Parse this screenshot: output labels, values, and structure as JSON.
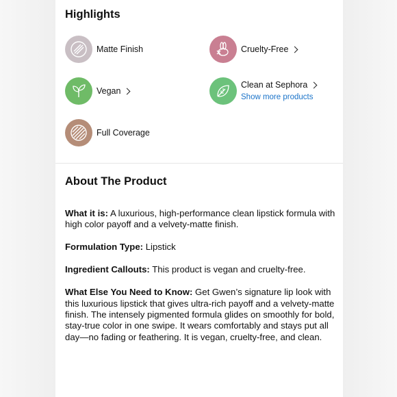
{
  "highlights": {
    "title": "Highlights",
    "items": [
      {
        "label": "Matte Finish",
        "icon": "matte-finish-icon",
        "color": "#c9bfc4",
        "chevron": false
      },
      {
        "label": "Cruelty-Free",
        "icon": "bunny-icon",
        "color": "#c97f92",
        "chevron": true
      },
      {
        "label": "Vegan",
        "icon": "leaf-sprout-icon",
        "color": "#6fbb67",
        "chevron": true
      },
      {
        "label": "Clean at Sephora",
        "icon": "clean-leaf-icon",
        "color": "#6cc27b",
        "chevron": true,
        "link": "Show more products"
      },
      {
        "label": "Full Coverage",
        "icon": "full-coverage-icon",
        "color": "#b58d78",
        "chevron": false
      }
    ]
  },
  "about": {
    "title": "About The Product",
    "paragraphs": [
      {
        "heading": "What it is:",
        "text": " A luxurious, high-performance clean lipstick formula with high color payoff and a velvety-matte finish."
      },
      {
        "heading": "Formulation Type:",
        "text": " Lipstick"
      },
      {
        "heading": "Ingredient Callouts:",
        "text": " This product is vegan and cruelty-free."
      },
      {
        "heading": "What Else You Need to Know:",
        "text": " Get Gwen’s signature lip look with this luxurious lipstick that gives ultra-rich payoff and a velvety-matte finish. The intensely pigmented formula glides on smoothly for bold, stay-true color in one swipe. It wears comfortably and stays put all day—no fading or feathering. It is vegan, cruelty-free, and clean."
      }
    ]
  }
}
